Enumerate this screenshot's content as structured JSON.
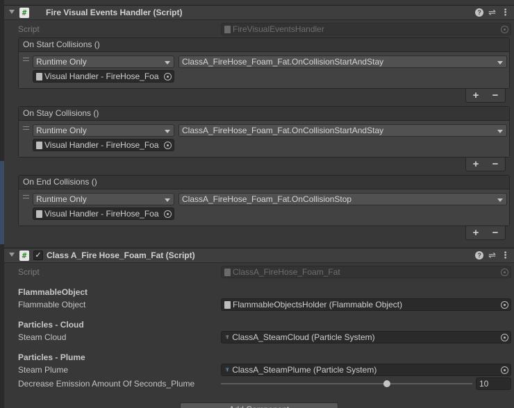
{
  "fire_handler": {
    "title": "Fire Visual Events Handler (Script)",
    "script_label": "Script",
    "script_value": "FireVisualEventsHandler",
    "events": [
      {
        "name": "On Start Collisions ()",
        "runtime": "Runtime Only",
        "function": "ClassA_FireHose_Foam_Fat.OnCollisionStartAndStay",
        "target": "Visual Handler -  FireHose_Foa"
      },
      {
        "name": "On Stay Collisions ()",
        "runtime": "Runtime Only",
        "function": "ClassA_FireHose_Foam_Fat.OnCollisionStartAndStay",
        "target": "Visual Handler -  FireHose_Foa"
      },
      {
        "name": "On End Collisions ()",
        "runtime": "Runtime Only",
        "function": "ClassA_FireHose_Foam_Fat.OnCollisionStop",
        "target": "Visual Handler -  FireHose_Foa"
      }
    ],
    "add_symbol": "+",
    "remove_symbol": "−"
  },
  "class_a": {
    "title": "Class A_Fire Hose_Foam_Fat (Script)",
    "checked": true,
    "check_glyph": "✓",
    "script_label": "Script",
    "script_value": "ClassA_FireHose_Foam_Fat",
    "flammable_section": "FlammableObject",
    "flammable_label": "Flammable Object",
    "flammable_value": "FlammableObjectsHolder (Flammable Object)",
    "cloud_section": "Particles - Cloud",
    "cloud_label": "Steam Cloud",
    "cloud_value": "ClassA_SteamCloud (Particle System)",
    "plume_section": "Particles - Plume",
    "plume_label": "Steam Plume",
    "plume_value": "ClassA_SteamPlume (Particle System)",
    "decrease_label": "Decrease Emission Amount Of Seconds_Plume",
    "decrease_value": "10",
    "slider_fraction": 0.66
  },
  "add_component_label": "Add Component",
  "icons": {
    "script": "#",
    "help": "?",
    "preset": "⇌",
    "menu": "⋮",
    "particle": "♆"
  },
  "colors": {
    "panel_bg": "#383838",
    "header_bg": "#3e3e3e",
    "field_bg": "#2a2a2a",
    "script_icon_green": "#2f8f2f",
    "particle_icon_blue": "#8fc7ff"
  }
}
